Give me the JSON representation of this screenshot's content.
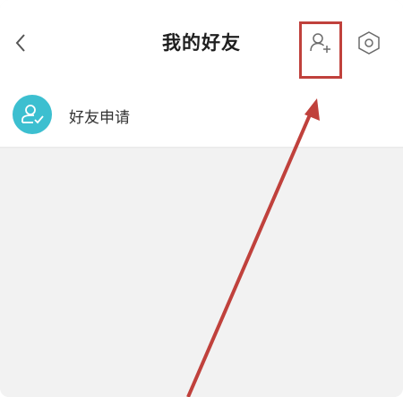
{
  "header": {
    "title": "我的好友",
    "back_icon": "chevron-left-icon",
    "add_icon": "add-friend-icon",
    "settings_icon": "hexagon-settings-icon"
  },
  "friend_request": {
    "label": "好友申请",
    "icon": "user-check-icon"
  },
  "colors": {
    "accent": "#3cbfd0",
    "annotation": "#c0413c",
    "background": "#f2f2f2"
  }
}
